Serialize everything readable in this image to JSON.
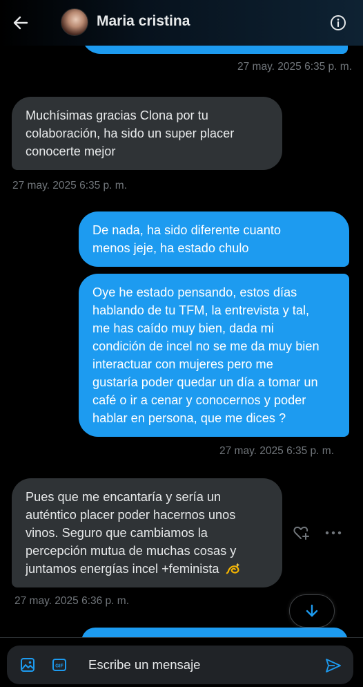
{
  "header": {
    "contact_name": "Maria cristina",
    "back_icon": "arrow-left-icon",
    "info_icon": "info-circle-icon"
  },
  "messages": [
    {
      "direction": "outgoing",
      "text": "",
      "timestamp": "27 may. 2025 6:35 p. m."
    },
    {
      "direction": "incoming",
      "lines": [
        "Muchísimas gracias Clona por tu",
        "colaboración, ha sido un super placer",
        "conocerte mejor"
      ],
      "timestamp": "27 may. 2025 6:35 p. m."
    },
    {
      "direction": "outgoing",
      "lines": [
        "De nada, ha sido diferente cuanto",
        "menos jeje, ha estado chulo"
      ]
    },
    {
      "direction": "outgoing",
      "lines": [
        "Oye he estado pensando, estos días",
        "hablando de tu TFM, la entrevista y tal,",
        "me has caído muy bien, dada mi",
        "condición de incel no se me da muy bien",
        "interactuar con mujeres pero me",
        "gustaría poder quedar un día a tomar un",
        "café o ir a cenar y conocernos y poder",
        "hablar en persona, que me dices ?"
      ],
      "timestamp": "27 may. 2025 6:35 p. m."
    },
    {
      "direction": "incoming",
      "lines": [
        "Pues que me encantaría y sería un",
        "auténtico placer poder hacernos unos",
        "vinos. Seguro que cambiamos la",
        "percepción mutua de muchas cosas y",
        "juntamos energías incel +feminista"
      ],
      "emoji": "dizzy-emoji",
      "timestamp": "27 may. 2025 6:36 p. m."
    }
  ],
  "composer": {
    "placeholder": "Escribe un mensaje",
    "media_icon": "image-icon",
    "gif_icon": "gif-icon",
    "send_icon": "send-icon"
  },
  "colors": {
    "outgoing_bubble": "#1d9bf0",
    "incoming_bubble": "#2f3336",
    "timestamp": "#71767b",
    "background": "#000000"
  }
}
